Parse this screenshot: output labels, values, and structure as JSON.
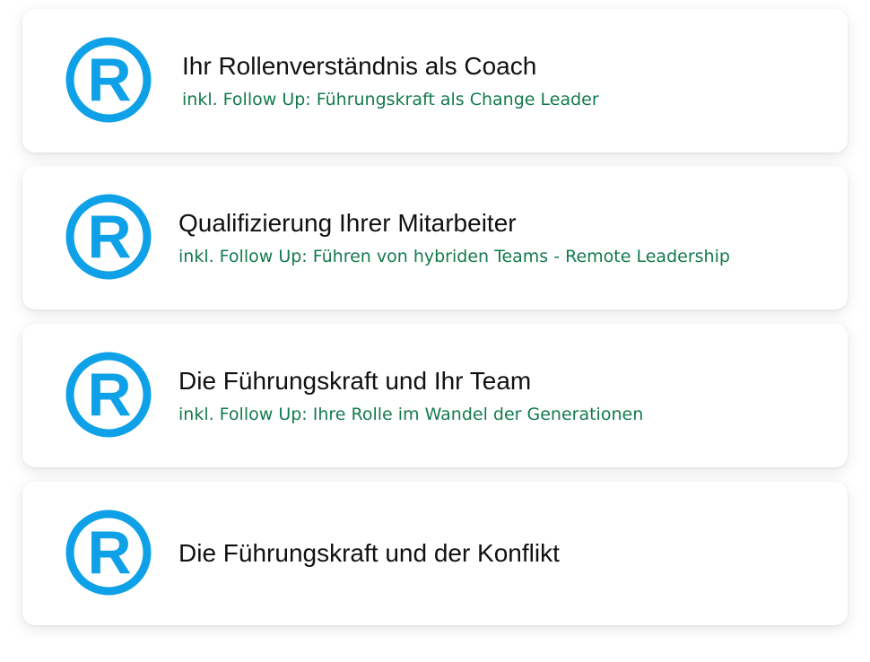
{
  "colors": {
    "icon": "#0ea1e8",
    "title": "#111111",
    "subtitle": "#137a4f"
  },
  "modules": [
    {
      "icon": "registered-icon",
      "title": "Ihr Rollenverständnis als Coach",
      "subtitle": "inkl. Follow Up: Führungskraft als Change Leader"
    },
    {
      "icon": "registered-icon",
      "title": "Qualifizierung Ihrer Mitarbeiter",
      "subtitle": "inkl. Follow Up: Führen von hybriden Teams - Remote Leadership"
    },
    {
      "icon": "registered-icon",
      "title": "Die Führungskraft und Ihr Team",
      "subtitle": "inkl. Follow Up: Ihre Rolle im Wandel der Generationen"
    },
    {
      "icon": "registered-icon",
      "title": "Die Führungskraft und der Konflikt",
      "subtitle": ""
    }
  ]
}
